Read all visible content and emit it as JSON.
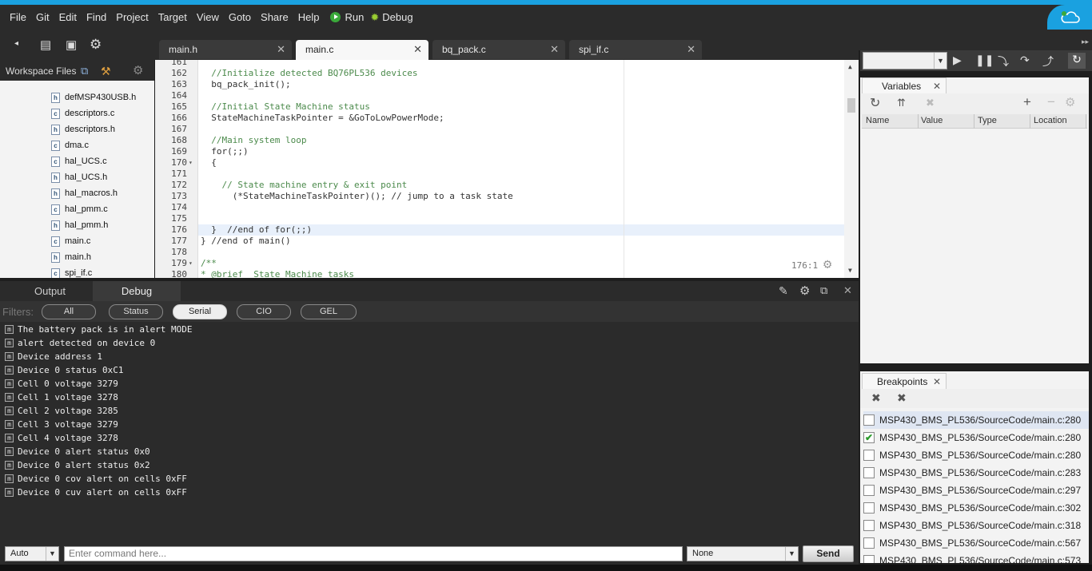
{
  "menu": [
    "File",
    "Git",
    "Edit",
    "Find",
    "Project",
    "Target",
    "View",
    "Goto",
    "Share",
    "Help"
  ],
  "run_label": "Run",
  "debug_label": "Debug",
  "editor_tabs": [
    {
      "label": "main.h",
      "active": false
    },
    {
      "label": "main.c",
      "active": true
    },
    {
      "label": "bq_pack.c",
      "active": false
    },
    {
      "label": "spi_if.c",
      "active": false
    }
  ],
  "workspace": {
    "title": "Workspace Files",
    "files": [
      {
        "name": "defMSP430USB.h",
        "type": "h"
      },
      {
        "name": "descriptors.c",
        "type": "c"
      },
      {
        "name": "descriptors.h",
        "type": "h"
      },
      {
        "name": "dma.c",
        "type": "c"
      },
      {
        "name": "hal_UCS.c",
        "type": "c"
      },
      {
        "name": "hal_UCS.h",
        "type": "h"
      },
      {
        "name": "hal_macros.h",
        "type": "h"
      },
      {
        "name": "hal_pmm.c",
        "type": "c"
      },
      {
        "name": "hal_pmm.h",
        "type": "h"
      },
      {
        "name": "main.c",
        "type": "c"
      },
      {
        "name": "main.h",
        "type": "h"
      },
      {
        "name": "spi_if.c",
        "type": "c"
      }
    ]
  },
  "code": [
    {
      "ln": "161",
      "text": "",
      "fold": ""
    },
    {
      "ln": "162",
      "text": "  //Initialize detected BQ76PL536 devices",
      "fold": ""
    },
    {
      "ln": "163",
      "text": "  bq_pack_init();",
      "fold": ""
    },
    {
      "ln": "164",
      "text": "",
      "fold": ""
    },
    {
      "ln": "165",
      "text": "  //Initial State Machine status",
      "fold": ""
    },
    {
      "ln": "166",
      "text": "  StateMachineTaskPointer = &GoToLowPowerMode;",
      "fold": ""
    },
    {
      "ln": "167",
      "text": "",
      "fold": ""
    },
    {
      "ln": "168",
      "text": "  //Main system loop",
      "fold": ""
    },
    {
      "ln": "169",
      "text": "  for(;;)",
      "fold": ""
    },
    {
      "ln": "170",
      "text": "  {",
      "fold": "▾"
    },
    {
      "ln": "171",
      "text": "",
      "fold": ""
    },
    {
      "ln": "172",
      "text": "    // State machine entry & exit point",
      "fold": ""
    },
    {
      "ln": "173",
      "text": "      (*StateMachineTaskPointer)(); // jump to a task state",
      "fold": ""
    },
    {
      "ln": "174",
      "text": "",
      "fold": ""
    },
    {
      "ln": "175",
      "text": "",
      "fold": ""
    },
    {
      "ln": "176",
      "text": "  }  //end of for(;;)",
      "fold": ""
    },
    {
      "ln": "177",
      "text": "} //end of main()",
      "fold": ""
    },
    {
      "ln": "178",
      "text": "",
      "fold": ""
    },
    {
      "ln": "179",
      "text": "/**",
      "fold": "▾"
    },
    {
      "ln": "180",
      "text": "* @brief  State Machine tasks",
      "fold": ""
    }
  ],
  "cursor_pos": "176:1",
  "bottom_tabs": {
    "output": "Output",
    "debug": "Debug"
  },
  "filters": {
    "label": "Filters:",
    "buttons": [
      "All",
      "Status",
      "Serial",
      "CIO",
      "GEL"
    ],
    "active": "Serial"
  },
  "console_lines": [
    "The battery pack is in alert MODE",
    "alert detected on device 0",
    "Device address 1",
    "Device 0 status 0xC1",
    "Cell 0 voltage 3279",
    "Cell 1 voltage 3278",
    "Cell 2 voltage 3285",
    "Cell 3 voltage 3279",
    "Cell 4 voltage 3278",
    "Device 0 alert status 0x0",
    "Device 0 alert status 0x2",
    "Device 0 cov alert on cells 0xFF",
    "Device 0 cuv alert on cells 0xFF"
  ],
  "cmdbar": {
    "auto": "Auto",
    "placeholder": "Enter command here...",
    "none": "None",
    "send": "Send"
  },
  "variables": {
    "title": "Variables",
    "columns": [
      "Name",
      "Value",
      "Type",
      "Location"
    ]
  },
  "breakpoints": {
    "title": "Breakpoints",
    "items": [
      {
        "label": "MSP430_BMS_PL536/SourceCode/main.c:280",
        "checked": false,
        "selected": true
      },
      {
        "label": "MSP430_BMS_PL536/SourceCode/main.c:280",
        "checked": true,
        "selected": false
      },
      {
        "label": "MSP430_BMS_PL536/SourceCode/main.c:280",
        "checked": false,
        "selected": false
      },
      {
        "label": "MSP430_BMS_PL536/SourceCode/main.c:283",
        "checked": false,
        "selected": false
      },
      {
        "label": "MSP430_BMS_PL536/SourceCode/main.c:297",
        "checked": false,
        "selected": false
      },
      {
        "label": "MSP430_BMS_PL536/SourceCode/main.c:302",
        "checked": false,
        "selected": false
      },
      {
        "label": "MSP430_BMS_PL536/SourceCode/main.c:318",
        "checked": false,
        "selected": false
      },
      {
        "label": "MSP430_BMS_PL536/SourceCode/main.c:567",
        "checked": false,
        "selected": false
      },
      {
        "label": "MSP430_BMS_PL536/SourceCode/main.c:573",
        "checked": false,
        "selected": false
      }
    ]
  },
  "colors": {
    "accent": "#1aa1e0",
    "run": "#3aa93a"
  }
}
